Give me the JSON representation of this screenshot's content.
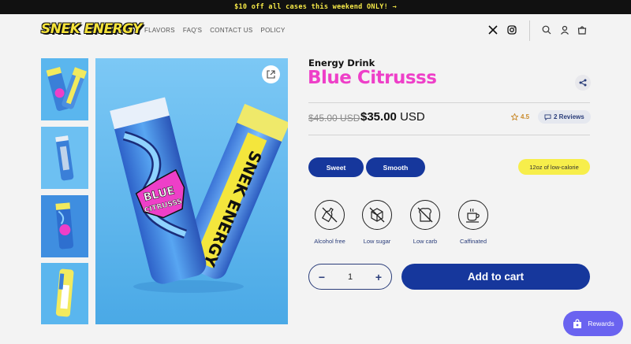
{
  "announcement": {
    "text": "$10 off all cases this weekend ONLY! →"
  },
  "header": {
    "logo": "SNEK ENERGY",
    "nav": [
      "FLAVORS",
      "FAQ'S",
      "CONTACT US",
      "POLICY"
    ],
    "icons": [
      "x-icon",
      "instagram-icon",
      "search-icon",
      "account-icon",
      "cart-icon"
    ]
  },
  "product": {
    "subtitle": "Energy Drink",
    "title": "Blue Citrusss",
    "old_price": "$45.00 USD",
    "price_amount": "$35.00",
    "price_currency": "USD",
    "rating": "4.5",
    "reviews": "2 Reviews",
    "tags": [
      "Sweet",
      "Smooth"
    ],
    "calorie_badge": "12oz of low-calorie",
    "features": [
      "Alcohol free",
      "Low sugar",
      "Low carb",
      "Caffinated"
    ],
    "quantity": "1",
    "add_to_cart": "Add to cart"
  },
  "rewards": {
    "label": "Rewards"
  },
  "colors": {
    "accent": "#16379c",
    "title": "#ee3fc8",
    "highlight": "#f7ee4b",
    "rewards": "#6a63f0"
  }
}
